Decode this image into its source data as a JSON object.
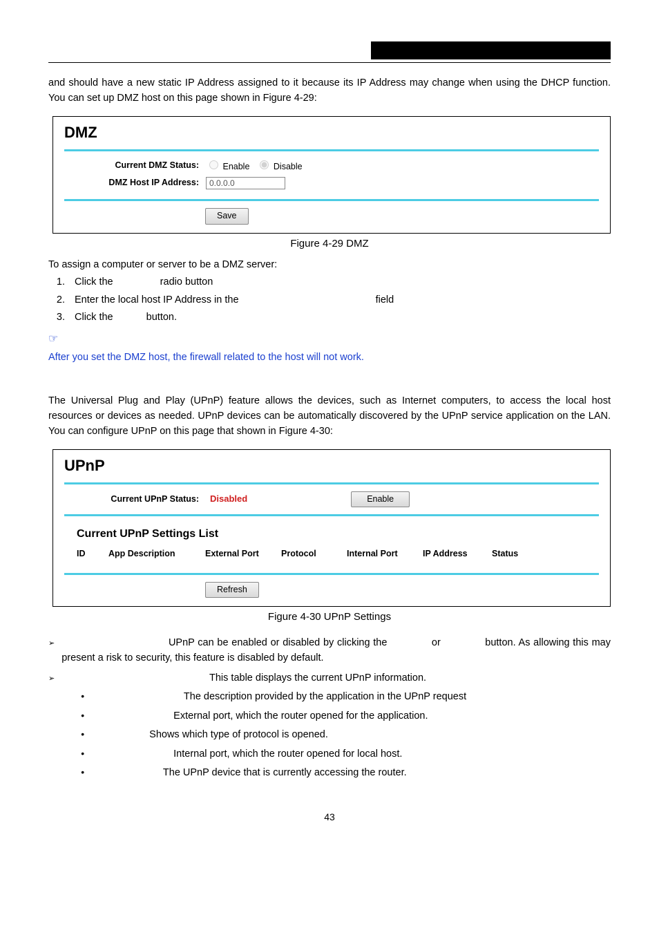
{
  "intro": "and should have a new static IP Address assigned to it because its IP Address may change when using the DHCP function. You can set up DMZ host on this page shown in Figure 4-29:",
  "fig29": {
    "title": "DMZ",
    "status_label": "Current DMZ Status:",
    "enable": "Enable",
    "disable": "Disable",
    "ip_label": "DMZ Host IP Address:",
    "ip_value": "0.0.0.0",
    "save": "Save",
    "caption": "Figure 4-29   DMZ"
  },
  "assign_lead": "To assign a computer or server to be a DMZ server:",
  "steps": [
    {
      "a": "Click the ",
      "b": " radio button"
    },
    {
      "a": "Enter the local host IP Address in the ",
      "b": " field"
    },
    {
      "a": "Click the ",
      "b": " button."
    }
  ],
  "note": "After you set the DMZ host, the firewall related to the host will not work.",
  "upnp_intro": "The Universal Plug and Play (UPnP) feature allows the devices, such as Internet computers, to access the local host resources or devices as needed. UPnP devices can be automatically discovered by the UPnP service application on the LAN. You can configure UPnP on this page that shown in Figure 4-30:",
  "fig30": {
    "title": "UPnP",
    "status_label": "Current UPnP Status:",
    "status_value": "Disabled",
    "enable_btn": "Enable",
    "list_title": "Current UPnP Settings List",
    "headers": [
      "ID",
      "App Description",
      "External Port",
      "Protocol",
      "Internal Port",
      "IP Address",
      "Status"
    ],
    "refresh": "Refresh",
    "caption": "Figure 4-30   UPnP Settings"
  },
  "b1": {
    "a": " UPnP can be enabled or disabled by clicking the ",
    "b": " or ",
    "c": " button. As allowing this may present a risk to security, this feature is disabled by default."
  },
  "b2": {
    "a": " This table displays the current UPnP information."
  },
  "subs": [
    " The description provided by the application in the UPnP request",
    " External port, which the router opened for the application.",
    " Shows which type of protocol is opened.",
    " Internal port, which the router opened for local host.",
    " The UPnP device that is currently accessing the router."
  ],
  "pagenum": "43"
}
